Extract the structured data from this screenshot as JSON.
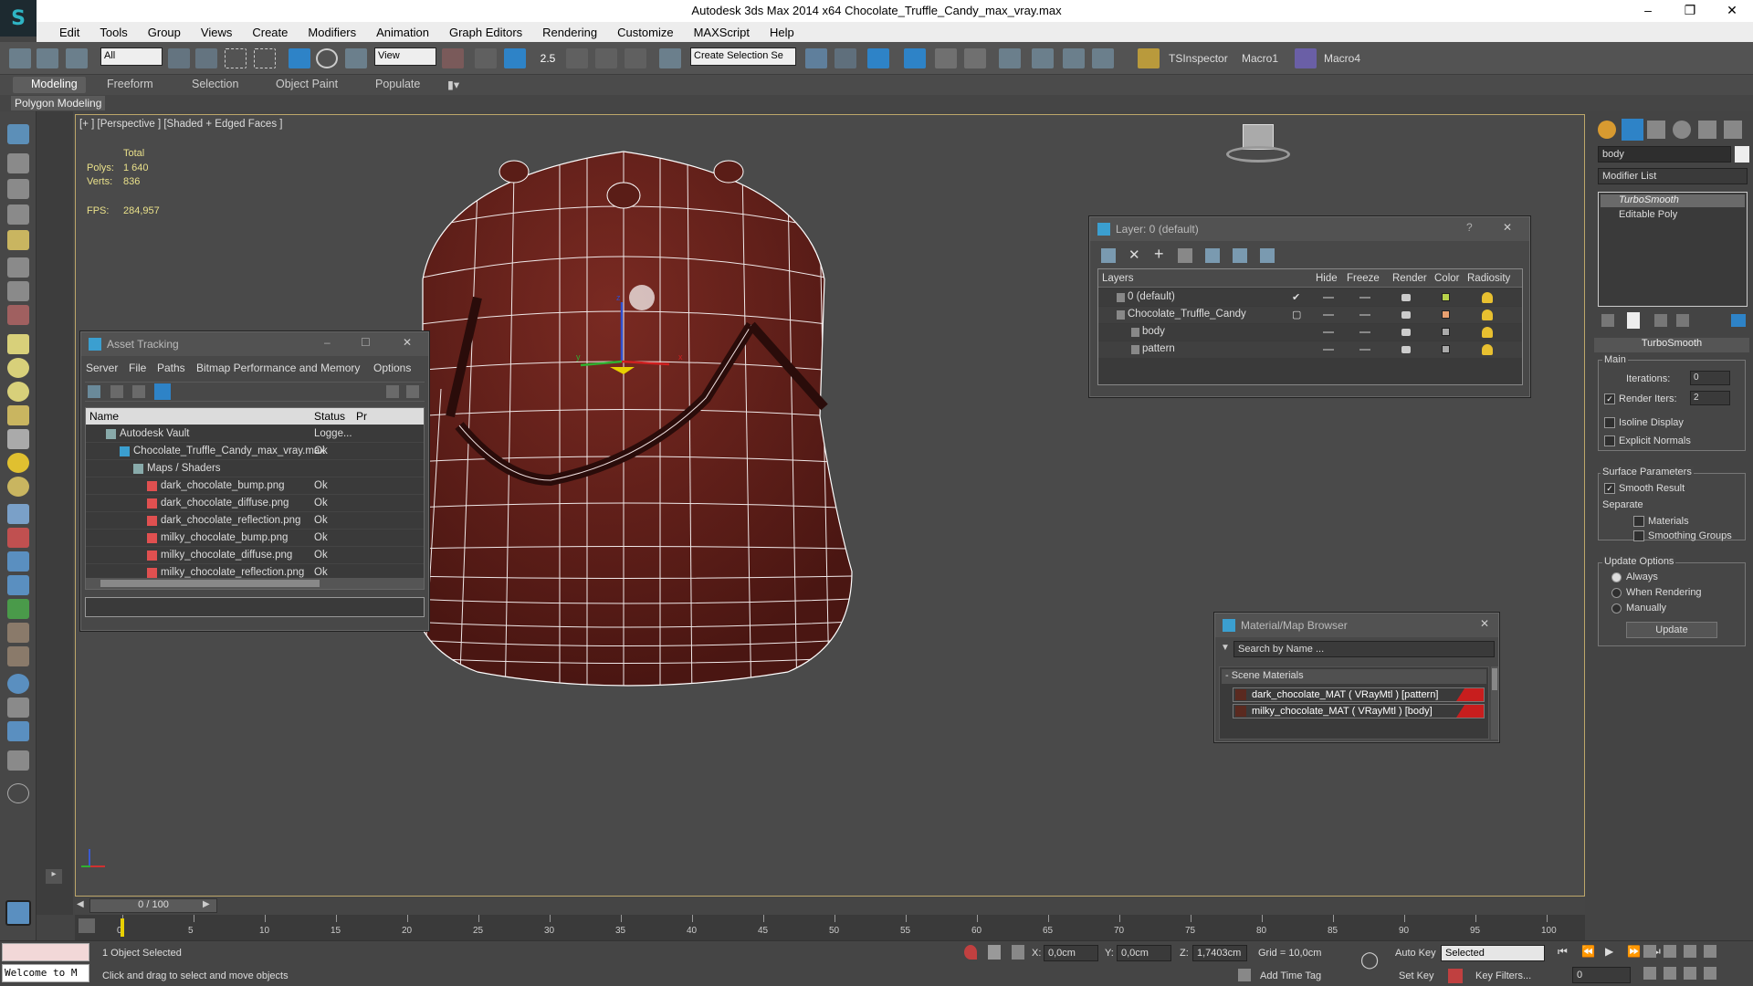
{
  "window": {
    "title": "Autodesk 3ds Max  2014 x64    Chocolate_Truffle_Candy_max_vray.max"
  },
  "menu": [
    "Edit",
    "Tools",
    "Group",
    "Views",
    "Create",
    "Modifiers",
    "Animation",
    "Graph Editors",
    "Rendering",
    "Customize",
    "MAXScript",
    "Help"
  ],
  "toolbar": {
    "filter": "All",
    "refcoord": "View",
    "snap_value": "2.5",
    "selection_set": "Create Selection Se",
    "tsinspector": "TSInspector",
    "macro1": "Macro1",
    "macro4": "Macro4"
  },
  "ribbon": {
    "tabs": [
      "Modeling",
      "Freeform",
      "Selection",
      "Object Paint",
      "Populate"
    ],
    "sub": "Polygon Modeling"
  },
  "viewport": {
    "label": "[+ ] [Perspective ] [Shaded + Edged Faces ]",
    "total": "Total",
    "polys_label": "Polys:",
    "polys": "1 640",
    "verts_label": "Verts:",
    "verts": "836",
    "fps_label": "FPS:",
    "fps": "284,957",
    "axis_x": "x",
    "axis_y": "y",
    "axis_z": "z"
  },
  "asset_tracking": {
    "title": "Asset Tracking",
    "menu": [
      "Server",
      "File",
      "Paths",
      "Bitmap Performance and Memory",
      "Options"
    ],
    "col_name": "Name",
    "col_status": "Status",
    "col_p": "Pr",
    "rows": [
      {
        "name": "Autodesk Vault",
        "status": "Logge...",
        "indent": 0
      },
      {
        "name": "Chocolate_Truffle_Candy_max_vray.max",
        "status": "Ok",
        "indent": 1
      },
      {
        "name": "Maps / Shaders",
        "status": "",
        "indent": 2
      },
      {
        "name": "dark_chocolate_bump.png",
        "status": "Ok",
        "indent": 3
      },
      {
        "name": "dark_chocolate_diffuse.png",
        "status": "Ok",
        "indent": 3
      },
      {
        "name": "dark_chocolate_reflection.png",
        "status": "Ok",
        "indent": 3
      },
      {
        "name": "milky_chocolate_bump.png",
        "status": "Ok",
        "indent": 3
      },
      {
        "name": "milky_chocolate_diffuse.png",
        "status": "Ok",
        "indent": 3
      },
      {
        "name": "milky_chocolate_reflection.png",
        "status": "Ok",
        "indent": 3
      }
    ]
  },
  "layer": {
    "title": "Layer: 0 (default)",
    "help": "?",
    "cols": [
      "Layers",
      "Hide",
      "Freeze",
      "Render",
      "Color",
      "Radiosity"
    ],
    "rows": [
      {
        "name": "0 (default)",
        "color": "#b7d24a"
      },
      {
        "name": "Chocolate_Truffle_Candy",
        "color": "#e8a070"
      },
      {
        "name": "body",
        "color": "#aaaaaa"
      },
      {
        "name": "pattern",
        "color": "#aaaaaa"
      }
    ]
  },
  "material": {
    "title": "Material/Map Browser",
    "search": "Search by Name ...",
    "section": "- Scene Materials",
    "items": [
      "dark_chocolate_MAT  ( VRayMtl )  [pattern]",
      "milky_chocolate_MAT  ( VRayMtl )  [body]"
    ]
  },
  "command": {
    "name": "body",
    "modifier_list": "Modifier List",
    "stack": [
      "TurboSmooth",
      "Editable Poly"
    ],
    "rollout": "TurboSmooth",
    "main": "Main",
    "iterations_label": "Iterations:",
    "iterations": "0",
    "render_iters_label": "Render Iters:",
    "render_iters": "2",
    "isoline": "Isoline Display",
    "explicit": "Explicit Normals",
    "surface": "Surface Parameters",
    "smooth_result": "Smooth Result",
    "separate": "Separate",
    "materials": "Materials",
    "smoothing": "Smoothing Groups",
    "update_options": "Update Options",
    "always": "Always",
    "when_rendering": "When Rendering",
    "manually": "Manually",
    "update": "Update"
  },
  "timeline": {
    "frame": "0 / 100",
    "ticks": [
      "0",
      "5",
      "10",
      "15",
      "20",
      "25",
      "30",
      "35",
      "40",
      "45",
      "50",
      "55",
      "60",
      "65",
      "70",
      "75",
      "80",
      "85",
      "90",
      "95",
      "100"
    ]
  },
  "status": {
    "welcome": "Welcome to M",
    "selected": "1 Object Selected",
    "prompt": "Click and drag to select and move objects",
    "x_label": "X:",
    "x": "0,0cm",
    "y_label": "Y:",
    "y": "0,0cm",
    "z_label": "Z:",
    "z": "1,7403cm",
    "grid": "Grid = 10,0cm",
    "add_time_tag": "Add Time Tag",
    "auto_key": "Auto Key",
    "set_key": "Set Key",
    "key_mode": "Selected",
    "key_filters": "Key Filters...",
    "frame_field": "0"
  }
}
